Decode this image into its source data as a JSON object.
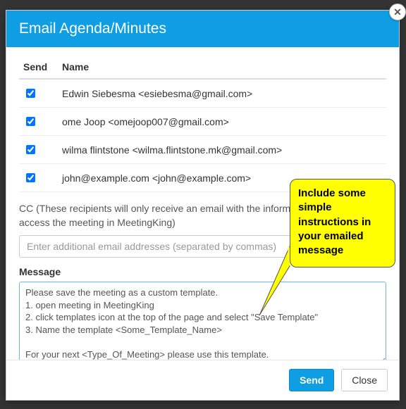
{
  "modal": {
    "title": "Email Agenda/Minutes",
    "close_icon": "✕"
  },
  "table": {
    "header_send": "Send",
    "header_name": "Name",
    "rows": [
      {
        "checked": true,
        "name": "Edwin Siebesma <esiebesma@gmail.com>"
      },
      {
        "checked": true,
        "name": "ome Joop <omejoop007@gmail.com>"
      },
      {
        "checked": true,
        "name": "wilma flintstone <wilma.flintstone.mk@gmail.com>"
      },
      {
        "checked": true,
        "name": "john@example.com <john@example.com>"
      }
    ]
  },
  "cc": {
    "label": "CC (These recipients will only receive an email with the information. They cannot access the meeting in MeetingKing)",
    "placeholder": "Enter additional email addresses (separated by commas)"
  },
  "message": {
    "label": "Message",
    "value": "Please save the meeting as a custom template.\n1. open meeting in MeetingKing\n2. click templates icon at the top of the page and select \"Save Template\"\n3. Name the template <Some_Template_Name>\n\nFor your next <Type_Of_Meeting> please use this template."
  },
  "footer": {
    "send": "Send",
    "close": "Close"
  },
  "callout": {
    "text": "Include some simple instructions in your emailed message"
  }
}
